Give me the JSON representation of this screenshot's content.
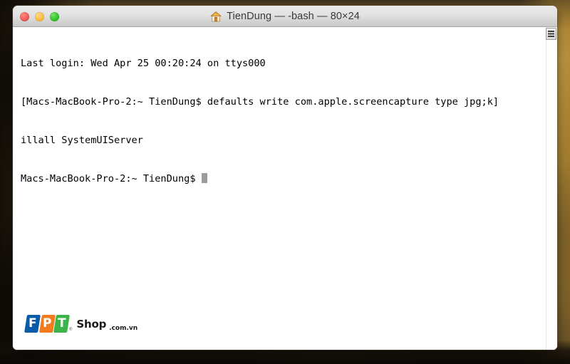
{
  "desktop": {
    "wallpaper_description": "blurred warm golden photo with dark left and bottom edges",
    "colors": {
      "gold": "#c89c3e",
      "dark": "#241d13"
    }
  },
  "window": {
    "titlebar": {
      "title": "TienDung — -bash — 80×24",
      "home_icon": "home-icon",
      "buttons": [
        {
          "name": "close",
          "label": "Close",
          "color": "#f05b56"
        },
        {
          "name": "minimize",
          "label": "Minimize",
          "color": "#fcbb3f"
        },
        {
          "name": "zoom",
          "label": "Zoom",
          "color": "#2ec127"
        }
      ]
    },
    "terminal": {
      "lines": [
        "Last login: Wed Apr 25 00:20:24 on ttys000",
        "[Macs-MacBook-Pro-2:~ TienDung$ defaults write com.apple.screencapture type jpg;k]",
        "illall SystemUIServer",
        "Macs-MacBook-Pro-2:~ TienDung$ "
      ],
      "prompt": "Macs-MacBook-Pro-2:~ TienDung$ ",
      "cursor": "block",
      "cursor_color": "#9c9c9c",
      "foreground": "#000000",
      "background": "#ffffff",
      "size": "80×24"
    },
    "scrollbar": {
      "name": "vertical-scrollbar",
      "thumb_position": "top"
    }
  },
  "watermark": {
    "letters": [
      {
        "char": "F",
        "color": "#0a5ca8"
      },
      {
        "char": "P",
        "color": "#f47a20"
      },
      {
        "char": "T",
        "color": "#3cb44a"
      }
    ],
    "registered_mark": "®",
    "shop_text": "Shop",
    "domain_text": ".com.vn"
  }
}
